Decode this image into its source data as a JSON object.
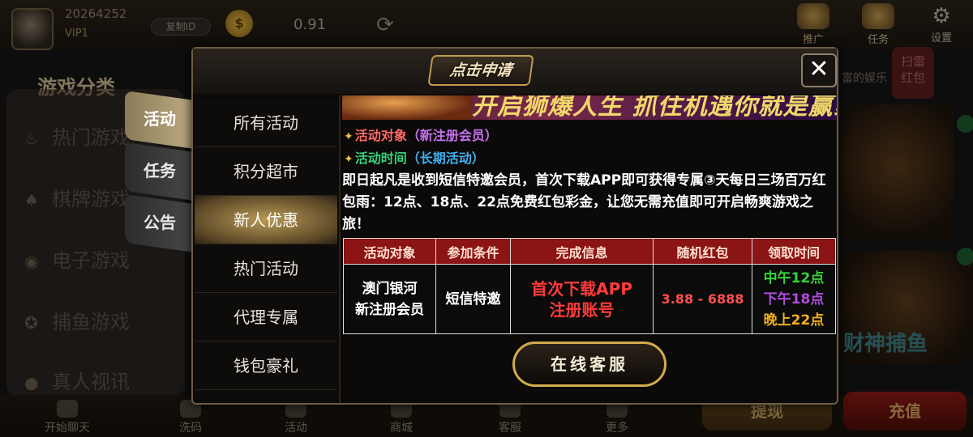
{
  "top_bar": {
    "user_id": "20264252",
    "vip_level": "VIP1",
    "copy_id_label": "复制ID",
    "balance": "0.91",
    "promote_label": "推广",
    "task_label": "任务",
    "settings_label": "设置"
  },
  "sidebar": {
    "title": "游戏分类",
    "items": [
      {
        "label": "热门游戏"
      },
      {
        "label": "棋牌游戏"
      },
      {
        "label": "电子游戏"
      },
      {
        "label": "捕鱼游戏"
      },
      {
        "label": "真人视讯"
      }
    ]
  },
  "right_side": {
    "marquee_text": "富的娱乐",
    "red_badge": "扫雷\n红包",
    "game_label": "财神捕鱼"
  },
  "bottom_bar": {
    "items": [
      {
        "label": "开始聊天"
      },
      {
        "label": "洗码"
      },
      {
        "label": "活动"
      },
      {
        "label": "商城"
      },
      {
        "label": "客服"
      },
      {
        "label": "更多"
      }
    ],
    "withdraw_label": "提现",
    "recharge_label": "充值"
  },
  "modal": {
    "header_button": "点击申请",
    "close_symbol": "✕",
    "tabs": [
      {
        "label": "活动",
        "active": true
      },
      {
        "label": "任务",
        "active": false
      },
      {
        "label": "公告",
        "active": false
      }
    ],
    "categories": [
      {
        "label": "所有活动"
      },
      {
        "label": "积分超市"
      },
      {
        "label": "新人优惠",
        "selected": true
      },
      {
        "label": "热门活动"
      },
      {
        "label": "代理专属"
      },
      {
        "label": "钱包豪礼"
      }
    ],
    "banner_text": "开启狮爆人生 抓住机遇你就是赢家",
    "target_label": "活动对象",
    "target_value": "（新注册会员）",
    "time_label": "活动时间",
    "time_value": "（长期活动）",
    "description": "即日起凡是收到短信特邀会员，首次下载APP即可获得专属③天每日三场百万红包雨：12点、18点、22点免费红包彩金，让您无需充值即可开启畅爽游戏之旅！",
    "table": {
      "headers": [
        "活动对象",
        "参加条件",
        "完成信息",
        "随机红包",
        "领取时间"
      ],
      "row": {
        "target_line1": "澳门银河",
        "target_line2": "新注册会员",
        "condition": "短信特邀",
        "finish_line1": "首次下载APP",
        "finish_line2": "注册账号",
        "random_range": "3.88 - 6888",
        "time1": "中午12点",
        "time2": "下午18点",
        "time3": "晚上22点"
      }
    },
    "service_button": "在线客服"
  },
  "colors": {
    "table_header_bg": "#8b1414",
    "gold_border": "#d4aa4c",
    "selected_category": "#b89a56"
  }
}
